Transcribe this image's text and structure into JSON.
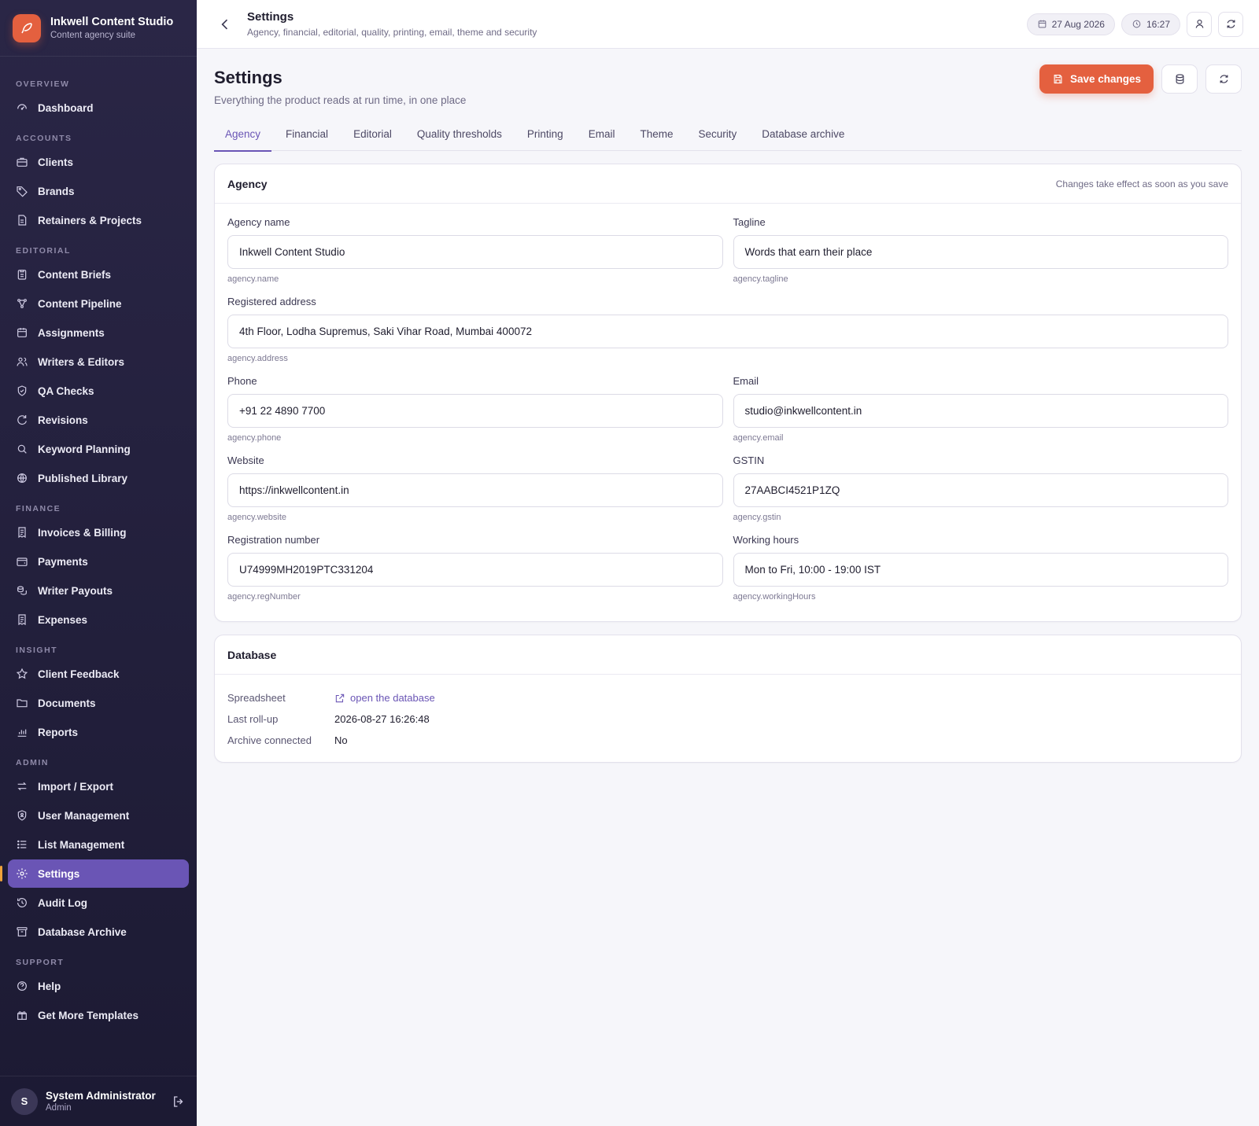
{
  "app": {
    "name": "Inkwell Content Studio",
    "subtitle": "Content agency suite"
  },
  "sidebar": {
    "sections": [
      {
        "title": "OVERVIEW",
        "items": [
          {
            "label": "Dashboard",
            "icon": "dashboard-icon"
          }
        ]
      },
      {
        "title": "ACCOUNTS",
        "items": [
          {
            "label": "Clients",
            "icon": "briefcase-icon"
          },
          {
            "label": "Brands",
            "icon": "tag-icon"
          },
          {
            "label": "Retainers & Projects",
            "icon": "file-icon"
          }
        ]
      },
      {
        "title": "EDITORIAL",
        "items": [
          {
            "label": "Content Briefs",
            "icon": "clipboard-icon"
          },
          {
            "label": "Content Pipeline",
            "icon": "workflow-icon"
          },
          {
            "label": "Assignments",
            "icon": "calendar-icon"
          },
          {
            "label": "Writers & Editors",
            "icon": "users-icon"
          },
          {
            "label": "QA Checks",
            "icon": "shield-check-icon"
          },
          {
            "label": "Revisions",
            "icon": "refresh-icon"
          },
          {
            "label": "Keyword Planning",
            "icon": "search-icon"
          },
          {
            "label": "Published Library",
            "icon": "globe-icon"
          }
        ]
      },
      {
        "title": "FINANCE",
        "items": [
          {
            "label": "Invoices & Billing",
            "icon": "receipt-icon"
          },
          {
            "label": "Payments",
            "icon": "wallet-icon"
          },
          {
            "label": "Writer Payouts",
            "icon": "coins-icon"
          },
          {
            "label": "Expenses",
            "icon": "receipt-icon"
          }
        ]
      },
      {
        "title": "INSIGHT",
        "items": [
          {
            "label": "Client Feedback",
            "icon": "star-icon"
          },
          {
            "label": "Documents",
            "icon": "folder-icon"
          },
          {
            "label": "Reports",
            "icon": "bar-chart-icon"
          }
        ]
      },
      {
        "title": "ADMIN",
        "items": [
          {
            "label": "Import / Export",
            "icon": "arrows-icon"
          },
          {
            "label": "User Management",
            "icon": "user-shield-icon"
          },
          {
            "label": "List Management",
            "icon": "list-icon"
          },
          {
            "label": "Settings",
            "icon": "gear-icon",
            "active": true
          },
          {
            "label": "Audit Log",
            "icon": "history-icon"
          },
          {
            "label": "Database Archive",
            "icon": "archive-icon"
          }
        ]
      },
      {
        "title": "SUPPORT",
        "items": [
          {
            "label": "Help",
            "icon": "help-icon"
          },
          {
            "label": "Get More Templates",
            "icon": "gift-icon"
          }
        ]
      }
    ]
  },
  "user": {
    "initial": "S",
    "name": "System Administrator",
    "role": "Admin"
  },
  "topbar": {
    "title": "Settings",
    "subtitle": "Agency, financial, editorial, quality, printing, email, theme and security",
    "date": "27 Aug 2026",
    "time": "16:27"
  },
  "page": {
    "title": "Settings",
    "subtitle": "Everything the product reads at run time, in one place",
    "save_label": "Save changes"
  },
  "tabs": [
    "Agency",
    "Financial",
    "Editorial",
    "Quality thresholds",
    "Printing",
    "Email",
    "Theme",
    "Security",
    "Database archive"
  ],
  "agency_card": {
    "title": "Agency",
    "note": "Changes take effect as soon as you save",
    "fields": {
      "name": {
        "label": "Agency name",
        "value": "Inkwell Content Studio",
        "key": "agency.name"
      },
      "tagline": {
        "label": "Tagline",
        "value": "Words that earn their place",
        "key": "agency.tagline"
      },
      "address": {
        "label": "Registered address",
        "value": "4th Floor, Lodha Supremus, Saki Vihar Road, Mumbai 400072",
        "key": "agency.address"
      },
      "phone": {
        "label": "Phone",
        "value": "+91 22 4890 7700",
        "key": "agency.phone"
      },
      "email": {
        "label": "Email",
        "value": "studio@inkwellcontent.in",
        "key": "agency.email"
      },
      "website": {
        "label": "Website",
        "value": "https://inkwellcontent.in",
        "key": "agency.website"
      },
      "gstin": {
        "label": "GSTIN",
        "value": "27AABCI4521P1ZQ",
        "key": "agency.gstin"
      },
      "reg": {
        "label": "Registration number",
        "value": "U74999MH2019PTC331204",
        "key": "agency.regNumber"
      },
      "hours": {
        "label": "Working hours",
        "value": "Mon to Fri, 10:00 - 19:00 IST",
        "key": "agency.workingHours"
      }
    }
  },
  "database_card": {
    "title": "Database",
    "spreadsheet_label": "Spreadsheet",
    "spreadsheet_link": "open the database",
    "rollup_label": "Last roll-up",
    "rollup_value": "2026-08-27 16:26:48",
    "archive_label": "Archive connected",
    "archive_value": "No"
  },
  "colors": {
    "accent": "#6a55b5",
    "primary_button": "#e4603f",
    "sidebar_bg": "#2a2646"
  }
}
